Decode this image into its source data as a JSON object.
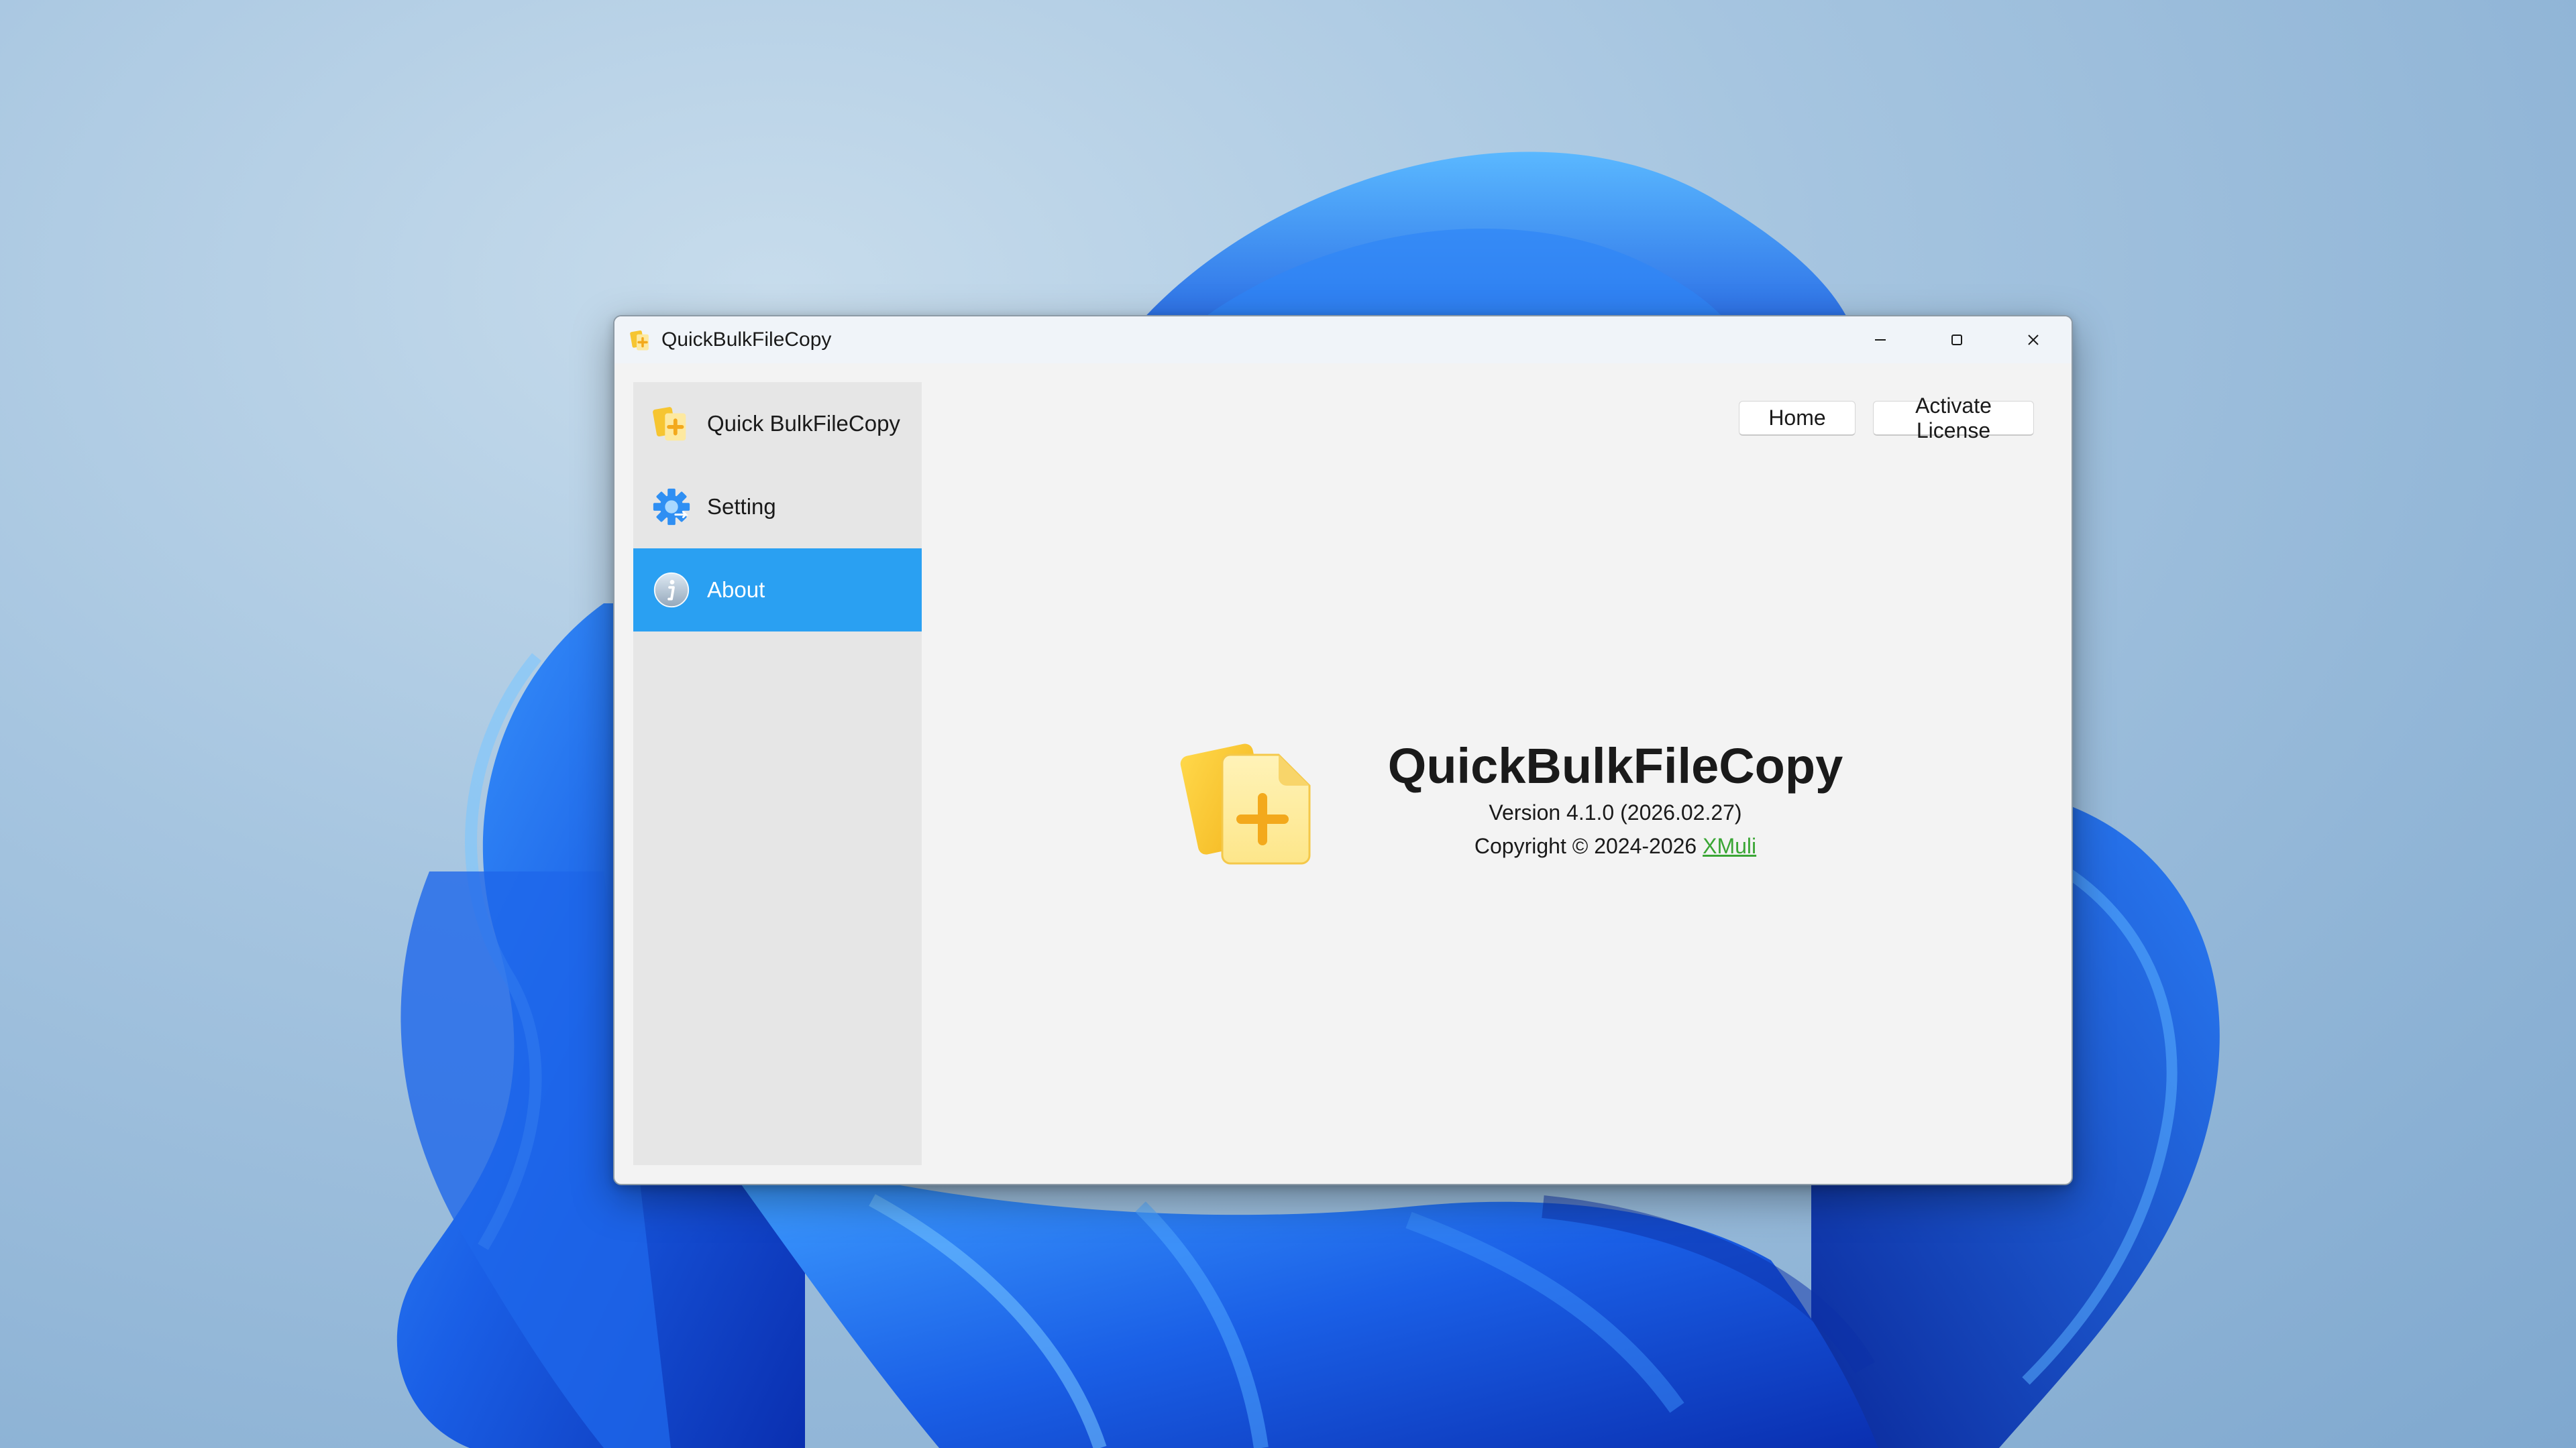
{
  "window": {
    "title": "QuickBulkFileCopy",
    "controls": {
      "minimize_icon": "minimize-icon",
      "maximize_icon": "maximize-icon",
      "close_icon": "close-icon"
    }
  },
  "sidebar": {
    "items": [
      {
        "label": "Quick BulkFileCopy",
        "icon": "app-logo-icon",
        "active": false
      },
      {
        "label": "Setting",
        "icon": "gear-icon",
        "active": false
      },
      {
        "label": "About",
        "icon": "info-icon",
        "active": true
      }
    ],
    "active_color": "#2aa0f2"
  },
  "toolbar": {
    "home_label": "Home",
    "activate_label": "Activate License"
  },
  "about": {
    "app_name": "QuickBulkFileCopy",
    "version": "Version 4.1.0 (2026.02.27)",
    "copyright_prefix": "Copyright © 2024-2026 ",
    "author": "XMuli",
    "link_color": "#3aa635"
  }
}
